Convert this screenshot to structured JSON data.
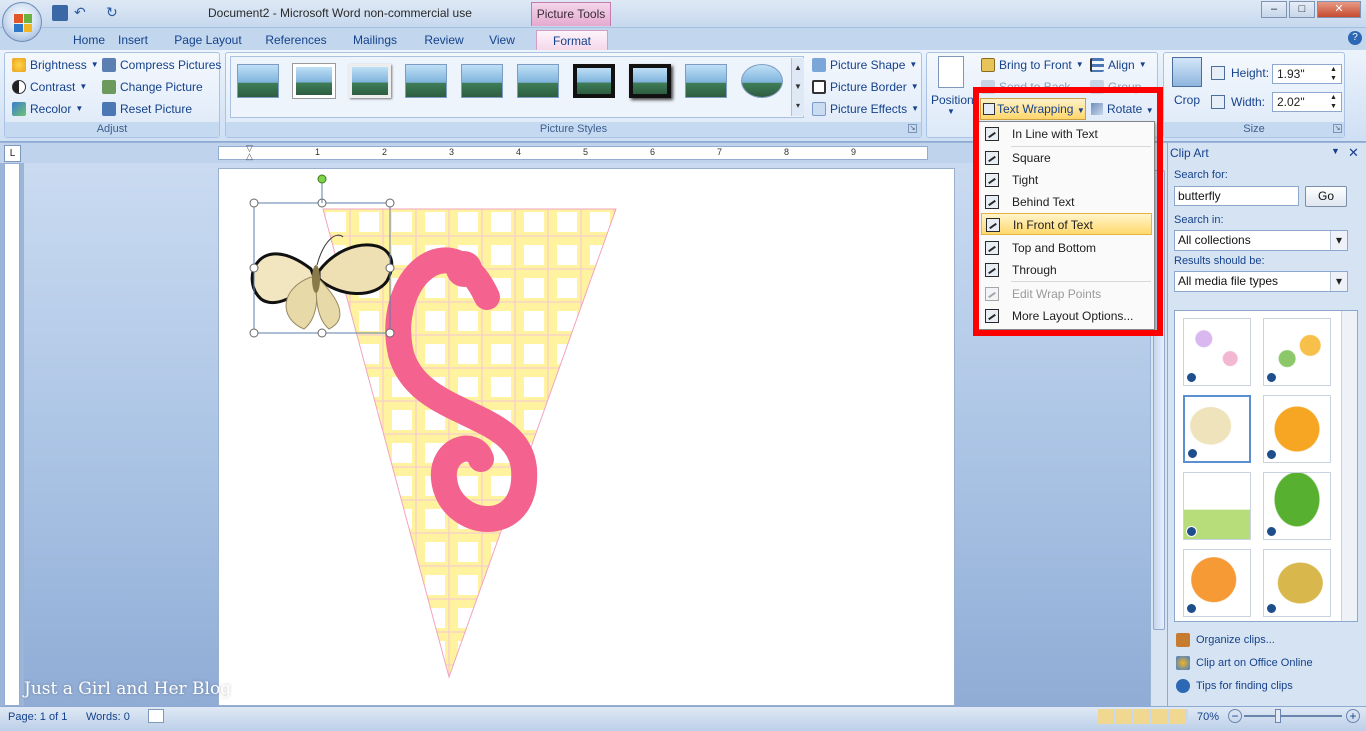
{
  "window": {
    "title": "Document2 - Microsoft Word non-commercial use",
    "context_tab": "Picture Tools",
    "controls": [
      "–",
      "□",
      "✕"
    ]
  },
  "tabs": [
    "Home",
    "Insert",
    "Page Layout",
    "References",
    "Mailings",
    "Review",
    "View",
    "Format"
  ],
  "active_tab": "Format",
  "ribbon": {
    "adjust": {
      "label": "Adjust",
      "brightness": "Brightness",
      "contrast": "Contrast",
      "recolor": "Recolor",
      "compress": "Compress Pictures",
      "change": "Change Picture",
      "reset": "Reset Picture"
    },
    "picture_styles": {
      "label": "Picture Styles",
      "shape": "Picture Shape",
      "border": "Picture Border",
      "effects": "Picture Effects"
    },
    "arrange": {
      "position": "Position",
      "bring_to_front": "Bring to Front",
      "send_to_back": "Send to Back",
      "align": "Align",
      "group": "Group",
      "text_wrapping": "Text Wrapping",
      "rotate": "Rotate"
    },
    "size": {
      "label": "Size",
      "crop": "Crop",
      "height_label": "Height:",
      "height": "1.93\"",
      "width_label": "Width:",
      "width": "2.02\""
    }
  },
  "text_wrapping_menu": [
    {
      "label": "In Line with Text",
      "state": "normal"
    },
    {
      "label": "Square",
      "state": "normal"
    },
    {
      "label": "Tight",
      "state": "normal"
    },
    {
      "label": "Behind Text",
      "state": "normal"
    },
    {
      "label": "In Front of Text",
      "state": "highlighted"
    },
    {
      "label": "Top and Bottom",
      "state": "normal"
    },
    {
      "label": "Through",
      "state": "normal"
    },
    {
      "label": "Edit Wrap Points",
      "state": "disabled"
    },
    {
      "label": "More Layout Options...",
      "state": "normal"
    }
  ],
  "ruler_numbers": [
    "1",
    "1",
    "2",
    "3",
    "4",
    "5",
    "6",
    "7",
    "8",
    "9"
  ],
  "document": {
    "watermark": "Just a Girl and Her Blog",
    "letter": "S"
  },
  "clip_art": {
    "title": "Clip Art",
    "search_label": "Search for:",
    "search_value": "butterfly",
    "go": "Go",
    "search_in_label": "Search in:",
    "search_in": "All collections",
    "results_label": "Results should be:",
    "results": "All media file types",
    "links": [
      "Organize clips...",
      "Clip art on Office Online",
      "Tips for finding clips"
    ]
  },
  "status": {
    "page": "Page: 1 of 1",
    "words": "Words: 0",
    "zoom": "70%"
  },
  "colors": {
    "highlight_box": "#ff0000",
    "pennant_yellow": "#fff4a8",
    "letter_pink": "#f4628f",
    "ribbon_blue": "#dbe8f7"
  }
}
